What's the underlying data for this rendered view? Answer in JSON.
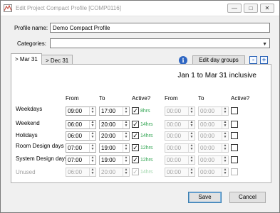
{
  "window": {
    "title": "Edit Project Compact Profile [COMP0116]",
    "minimize_icon": "minimize-icon",
    "maximize_icon": "maximize-icon",
    "close_icon": "close-icon"
  },
  "form": {
    "profile_name_label": "Profile name:",
    "profile_name_value": "Demo Compact Profile",
    "categories_label": "Categories:",
    "categories_value": ""
  },
  "tabs": [
    {
      "label": "> Mar 31",
      "active": true
    },
    {
      "label": "> Dec 31",
      "active": false
    }
  ],
  "toolbar": {
    "info_icon": "info-icon",
    "edit_day_groups_label": "Edit day groups",
    "minus_label": "-",
    "plus_label": "+"
  },
  "range_heading": "Jan 1 to Mar 31 inclusive",
  "columns": {
    "from": "From",
    "to": "To",
    "active": "Active?",
    "from2": "From",
    "to2": "To",
    "active2": "Active?"
  },
  "rows": [
    {
      "label": "Weekdays",
      "from": "09:00",
      "to": "17:00",
      "active": true,
      "hours": "8hrs",
      "from2": "00:00",
      "to2": "00:00",
      "active2": false,
      "disabled": false
    },
    {
      "label": "Weekend",
      "from": "06:00",
      "to": "20:00",
      "active": true,
      "hours": "14hrs",
      "from2": "00:00",
      "to2": "00:00",
      "active2": false,
      "disabled": false
    },
    {
      "label": "Holidays",
      "from": "06:00",
      "to": "20:00",
      "active": true,
      "hours": "14hrs",
      "from2": "00:00",
      "to2": "00:00",
      "active2": false,
      "disabled": false
    },
    {
      "label": "Room Design days",
      "from": "07:00",
      "to": "19:00",
      "active": true,
      "hours": "12hrs",
      "from2": "00:00",
      "to2": "00:00",
      "active2": false,
      "disabled": false
    },
    {
      "label": "System Design days",
      "from": "07:00",
      "to": "19:00",
      "active": true,
      "hours": "12hrs",
      "from2": "00:00",
      "to2": "00:00",
      "active2": false,
      "disabled": false
    },
    {
      "label": "Unused",
      "from": "06:00",
      "to": "20:00",
      "active": true,
      "hours": "14hrs",
      "from2": "00:00",
      "to2": "00:00",
      "active2": false,
      "disabled": true
    }
  ],
  "footer": {
    "save_label": "Save",
    "cancel_label": "Cancel"
  },
  "colors": {
    "hours_text": "#2ea44f",
    "accent_blue": "#2b63b7"
  }
}
